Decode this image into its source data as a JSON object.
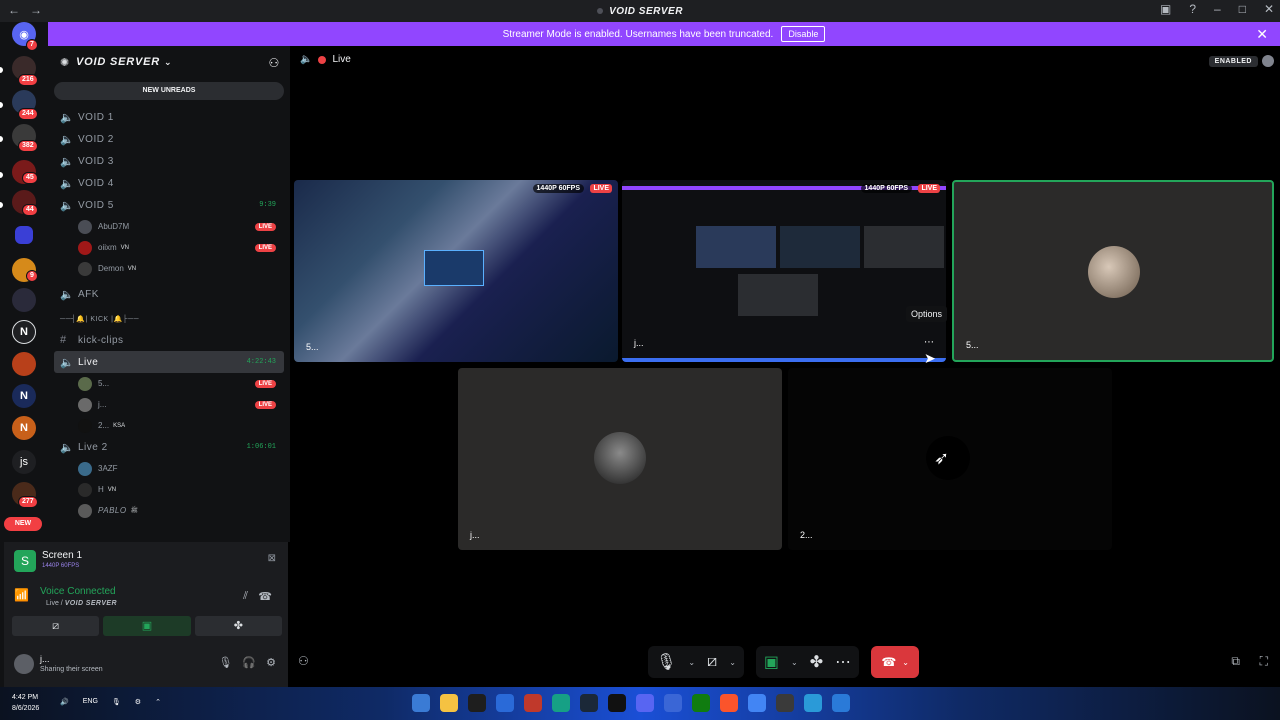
{
  "titlebar": {
    "title": "VOID SERVER"
  },
  "banner": {
    "text": "Streamer Mode is enabled. Usernames have been truncated.",
    "button": "Disable"
  },
  "rail": {
    "badges": [
      "7",
      "216",
      "244",
      "382",
      "45",
      "44",
      "9",
      "277"
    ],
    "new_label": "NEW",
    "js_label": "js"
  },
  "server": {
    "name": "VOID SERVER",
    "new_unreads": "NEW UNREADS"
  },
  "channels": [
    {
      "name": "VOID 1"
    },
    {
      "name": "VOID 2"
    },
    {
      "name": "VOID 3"
    },
    {
      "name": "VOID 4"
    },
    {
      "name": "VOID 5",
      "time": "9:39"
    }
  ],
  "void5_users": [
    {
      "name": "AbuD7M",
      "live": "LIVE"
    },
    {
      "name": "oiixm",
      "tag": "VN",
      "live": "LIVE"
    },
    {
      "name": "Demon",
      "tag": "VN"
    }
  ],
  "afk": "AFK",
  "category": "──┤🔔| KICK |🔔├──",
  "kick_clips": "kick-clips",
  "live_channel": {
    "name": "Live",
    "time": "4:22:43"
  },
  "live_users": [
    {
      "name": "5...",
      "live": "LIVE"
    },
    {
      "name": "j...",
      "live": "LIVE"
    },
    {
      "name": "2...",
      "tag": "KSA"
    }
  ],
  "live2_channel": {
    "name": "Live 2",
    "time": "1:06:01"
  },
  "live2_users": [
    {
      "name": "3AZF"
    },
    {
      "name": "H",
      "tag": "VN"
    },
    {
      "name": "PABLO",
      "tag": "ﷺ"
    }
  ],
  "userarea": {
    "screen_title": "Screen 1",
    "screen_quality": "1440P 60FPS",
    "voice_status": "Voice Connected",
    "voice_channel": "Live",
    "voice_server": "VOID SERVER",
    "me_name": "j...",
    "me_status": "Sharing their screen"
  },
  "stage": {
    "channel": "Live",
    "enabled": "ENABLED",
    "tooltip": "Options",
    "tiles": [
      {
        "label": "5...",
        "quality": "1440P 60FPS",
        "live": "LIVE"
      },
      {
        "label": "j...",
        "quality": "1440P 60FPS",
        "live": "LIVE"
      },
      {
        "label": "5..."
      },
      {
        "label": "j..."
      },
      {
        "label": "2..."
      }
    ]
  },
  "taskbar": {
    "time": "4:42 PM",
    "date": "8/6/2026",
    "lang": "ENG"
  },
  "colors": {
    "accent": "#9146ff",
    "green": "#23a55a",
    "red": "#ed4245",
    "sidebar": "#111214"
  }
}
